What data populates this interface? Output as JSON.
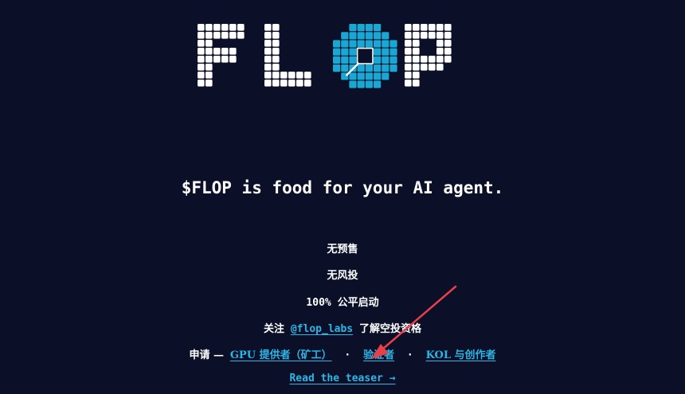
{
  "logo": {
    "text": "FLOP",
    "accent_color": "#1aa7d4",
    "block_color": "#ffffff"
  },
  "tagline": "$FLOP is food for your AI agent.",
  "features": {
    "no_presale": "无预售",
    "no_vc": "无风投",
    "fair_launch_pct": "100%",
    "fair_launch_text": "公平启动"
  },
  "follow": {
    "prefix": "关注",
    "handle": "@flop_labs",
    "suffix": "了解空投资格"
  },
  "apply": {
    "prefix": "申请 —",
    "gpu_link": "GPU 提供者（矿工）",
    "validator_link": "验证者",
    "kol_link": "KOL 与创作者",
    "separator": "·"
  },
  "teaser": {
    "label": "Read the teaser →"
  },
  "colors": {
    "background": "#0b1028",
    "link": "#2bb6e6",
    "annotation_arrow": "#e8404a"
  }
}
